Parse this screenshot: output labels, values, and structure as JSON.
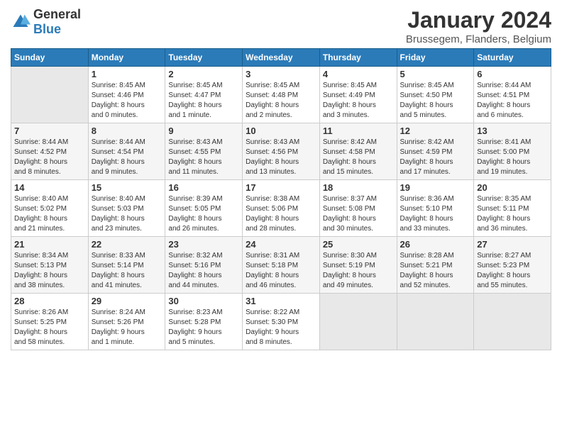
{
  "logo": {
    "text_general": "General",
    "text_blue": "Blue"
  },
  "header": {
    "title": "January 2024",
    "subtitle": "Brussegem, Flanders, Belgium"
  },
  "calendar": {
    "days_of_week": [
      "Sunday",
      "Monday",
      "Tuesday",
      "Wednesday",
      "Thursday",
      "Friday",
      "Saturday"
    ],
    "weeks": [
      [
        {
          "day": "",
          "info": ""
        },
        {
          "day": "1",
          "info": "Sunrise: 8:45 AM\nSunset: 4:46 PM\nDaylight: 8 hours\nand 0 minutes."
        },
        {
          "day": "2",
          "info": "Sunrise: 8:45 AM\nSunset: 4:47 PM\nDaylight: 8 hours\nand 1 minute."
        },
        {
          "day": "3",
          "info": "Sunrise: 8:45 AM\nSunset: 4:48 PM\nDaylight: 8 hours\nand 2 minutes."
        },
        {
          "day": "4",
          "info": "Sunrise: 8:45 AM\nSunset: 4:49 PM\nDaylight: 8 hours\nand 3 minutes."
        },
        {
          "day": "5",
          "info": "Sunrise: 8:45 AM\nSunset: 4:50 PM\nDaylight: 8 hours\nand 5 minutes."
        },
        {
          "day": "6",
          "info": "Sunrise: 8:44 AM\nSunset: 4:51 PM\nDaylight: 8 hours\nand 6 minutes."
        }
      ],
      [
        {
          "day": "7",
          "info": "Sunrise: 8:44 AM\nSunset: 4:52 PM\nDaylight: 8 hours\nand 8 minutes."
        },
        {
          "day": "8",
          "info": "Sunrise: 8:44 AM\nSunset: 4:54 PM\nDaylight: 8 hours\nand 9 minutes."
        },
        {
          "day": "9",
          "info": "Sunrise: 8:43 AM\nSunset: 4:55 PM\nDaylight: 8 hours\nand 11 minutes."
        },
        {
          "day": "10",
          "info": "Sunrise: 8:43 AM\nSunset: 4:56 PM\nDaylight: 8 hours\nand 13 minutes."
        },
        {
          "day": "11",
          "info": "Sunrise: 8:42 AM\nSunset: 4:58 PM\nDaylight: 8 hours\nand 15 minutes."
        },
        {
          "day": "12",
          "info": "Sunrise: 8:42 AM\nSunset: 4:59 PM\nDaylight: 8 hours\nand 17 minutes."
        },
        {
          "day": "13",
          "info": "Sunrise: 8:41 AM\nSunset: 5:00 PM\nDaylight: 8 hours\nand 19 minutes."
        }
      ],
      [
        {
          "day": "14",
          "info": "Sunrise: 8:40 AM\nSunset: 5:02 PM\nDaylight: 8 hours\nand 21 minutes."
        },
        {
          "day": "15",
          "info": "Sunrise: 8:40 AM\nSunset: 5:03 PM\nDaylight: 8 hours\nand 23 minutes."
        },
        {
          "day": "16",
          "info": "Sunrise: 8:39 AM\nSunset: 5:05 PM\nDaylight: 8 hours\nand 26 minutes."
        },
        {
          "day": "17",
          "info": "Sunrise: 8:38 AM\nSunset: 5:06 PM\nDaylight: 8 hours\nand 28 minutes."
        },
        {
          "day": "18",
          "info": "Sunrise: 8:37 AM\nSunset: 5:08 PM\nDaylight: 8 hours\nand 30 minutes."
        },
        {
          "day": "19",
          "info": "Sunrise: 8:36 AM\nSunset: 5:10 PM\nDaylight: 8 hours\nand 33 minutes."
        },
        {
          "day": "20",
          "info": "Sunrise: 8:35 AM\nSunset: 5:11 PM\nDaylight: 8 hours\nand 36 minutes."
        }
      ],
      [
        {
          "day": "21",
          "info": "Sunrise: 8:34 AM\nSunset: 5:13 PM\nDaylight: 8 hours\nand 38 minutes."
        },
        {
          "day": "22",
          "info": "Sunrise: 8:33 AM\nSunset: 5:14 PM\nDaylight: 8 hours\nand 41 minutes."
        },
        {
          "day": "23",
          "info": "Sunrise: 8:32 AM\nSunset: 5:16 PM\nDaylight: 8 hours\nand 44 minutes."
        },
        {
          "day": "24",
          "info": "Sunrise: 8:31 AM\nSunset: 5:18 PM\nDaylight: 8 hours\nand 46 minutes."
        },
        {
          "day": "25",
          "info": "Sunrise: 8:30 AM\nSunset: 5:19 PM\nDaylight: 8 hours\nand 49 minutes."
        },
        {
          "day": "26",
          "info": "Sunrise: 8:28 AM\nSunset: 5:21 PM\nDaylight: 8 hours\nand 52 minutes."
        },
        {
          "day": "27",
          "info": "Sunrise: 8:27 AM\nSunset: 5:23 PM\nDaylight: 8 hours\nand 55 minutes."
        }
      ],
      [
        {
          "day": "28",
          "info": "Sunrise: 8:26 AM\nSunset: 5:25 PM\nDaylight: 8 hours\nand 58 minutes."
        },
        {
          "day": "29",
          "info": "Sunrise: 8:24 AM\nSunset: 5:26 PM\nDaylight: 9 hours\nand 1 minute."
        },
        {
          "day": "30",
          "info": "Sunrise: 8:23 AM\nSunset: 5:28 PM\nDaylight: 9 hours\nand 5 minutes."
        },
        {
          "day": "31",
          "info": "Sunrise: 8:22 AM\nSunset: 5:30 PM\nDaylight: 9 hours\nand 8 minutes."
        },
        {
          "day": "",
          "info": ""
        },
        {
          "day": "",
          "info": ""
        },
        {
          "day": "",
          "info": ""
        }
      ]
    ]
  }
}
